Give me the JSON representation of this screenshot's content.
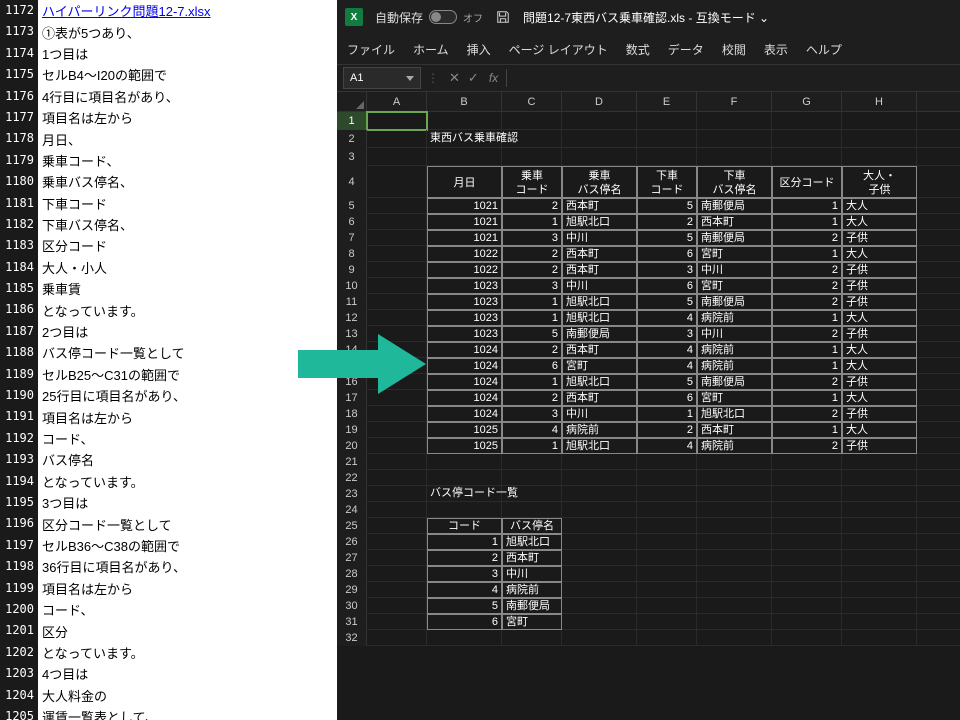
{
  "left": {
    "lines": [
      {
        "n": "1172",
        "t": "ハイパーリンク問題12-7.xlsx",
        "link": true
      },
      {
        "n": "1173",
        "t": "①表が5つあり、"
      },
      {
        "n": "1174",
        "t": "1つ目は"
      },
      {
        "n": "1175",
        "t": "セルB4～I20の範囲で"
      },
      {
        "n": "1176",
        "t": "4行目に項目名があり、"
      },
      {
        "n": "1177",
        "t": "項目名は左から"
      },
      {
        "n": "1178",
        "t": "月日、"
      },
      {
        "n": "1179",
        "t": "乗車コード、"
      },
      {
        "n": "1180",
        "t": "乗車バス停名、"
      },
      {
        "n": "1181",
        "t": "下車コード"
      },
      {
        "n": "1182",
        "t": "下車バス停名、"
      },
      {
        "n": "1183",
        "t": "区分コード"
      },
      {
        "n": "1184",
        "t": "大人・小人"
      },
      {
        "n": "1185",
        "t": "乗車賃"
      },
      {
        "n": "1186",
        "t": "となっています。"
      },
      {
        "n": "1187",
        "t": "2つ目は"
      },
      {
        "n": "1188",
        "t": "バス停コード一覧として"
      },
      {
        "n": "1189",
        "t": "セルB25～C31の範囲で"
      },
      {
        "n": "1190",
        "t": "25行目に項目名があり、"
      },
      {
        "n": "1191",
        "t": "項目名は左から"
      },
      {
        "n": "1192",
        "t": "コード、"
      },
      {
        "n": "1193",
        "t": "バス停名"
      },
      {
        "n": "1194",
        "t": "となっています。"
      },
      {
        "n": "1195",
        "t": "3つ目は"
      },
      {
        "n": "1196",
        "t": "区分コード一覧として"
      },
      {
        "n": "1197",
        "t": "セルB36～C38の範囲で"
      },
      {
        "n": "1198",
        "t": "36行目に項目名があり、"
      },
      {
        "n": "1199",
        "t": "項目名は左から"
      },
      {
        "n": "1200",
        "t": "コード、"
      },
      {
        "n": "1201",
        "t": "区分"
      },
      {
        "n": "1202",
        "t": "となっています。"
      },
      {
        "n": "1203",
        "t": "4つ目は"
      },
      {
        "n": "1204",
        "t": "大人料金の"
      },
      {
        "n": "1205",
        "t": "運賃一覧表として、"
      }
    ]
  },
  "titlebar": {
    "autosave": "自動保存",
    "toggle": "オフ",
    "doctitle": "問題12-7東西バス乗車確認.xls - 互換モード ⌄"
  },
  "ribbon": {
    "tabs": [
      "ファイル",
      "ホーム",
      "挿入",
      "ページ レイアウト",
      "数式",
      "データ",
      "校閲",
      "表示",
      "ヘルプ"
    ]
  },
  "namebox": "A1",
  "sheet": {
    "cols": [
      "A",
      "B",
      "C",
      "D",
      "E",
      "F",
      "G",
      "H"
    ],
    "title": "東西バス乗車確認",
    "headers": [
      "月日",
      "乗車\nコード",
      "乗車\nバス停名",
      "下車\nコード",
      "下車\nバス停名",
      "区分コード",
      "大人・\n子供"
    ],
    "rows": [
      [
        "1021",
        "2",
        "西本町",
        "5",
        "南郵便局",
        "1",
        "大人"
      ],
      [
        "1021",
        "1",
        "旭駅北口",
        "2",
        "西本町",
        "1",
        "大人"
      ],
      [
        "1021",
        "3",
        "中川",
        "5",
        "南郵便局",
        "2",
        "子供"
      ],
      [
        "1022",
        "2",
        "西本町",
        "6",
        "宮町",
        "1",
        "大人"
      ],
      [
        "1022",
        "2",
        "西本町",
        "3",
        "中川",
        "2",
        "子供"
      ],
      [
        "1023",
        "3",
        "中川",
        "6",
        "宮町",
        "2",
        "子供"
      ],
      [
        "1023",
        "1",
        "旭駅北口",
        "5",
        "南郵便局",
        "2",
        "子供"
      ],
      [
        "1023",
        "1",
        "旭駅北口",
        "4",
        "病院前",
        "1",
        "大人"
      ],
      [
        "1023",
        "5",
        "南郵便局",
        "3",
        "中川",
        "2",
        "子供"
      ],
      [
        "1024",
        "2",
        "西本町",
        "4",
        "病院前",
        "1",
        "大人"
      ],
      [
        "1024",
        "6",
        "宮町",
        "4",
        "病院前",
        "1",
        "大人"
      ],
      [
        "1024",
        "1",
        "旭駅北口",
        "5",
        "南郵便局",
        "2",
        "子供"
      ],
      [
        "1024",
        "2",
        "西本町",
        "6",
        "宮町",
        "1",
        "大人"
      ],
      [
        "1024",
        "3",
        "中川",
        "1",
        "旭駅北口",
        "2",
        "子供"
      ],
      [
        "1025",
        "4",
        "病院前",
        "2",
        "西本町",
        "1",
        "大人"
      ],
      [
        "1025",
        "1",
        "旭駅北口",
        "4",
        "病院前",
        "2",
        "子供"
      ]
    ],
    "section2_title": "バス停コード一覧",
    "section2_headers": [
      "コード",
      "バス停名"
    ],
    "section2_rows": [
      [
        "1",
        "旭駅北口"
      ],
      [
        "2",
        "西本町"
      ],
      [
        "3",
        "中川"
      ],
      [
        "4",
        "病院前"
      ],
      [
        "5",
        "南郵便局"
      ],
      [
        "6",
        "宮町"
      ]
    ]
  }
}
